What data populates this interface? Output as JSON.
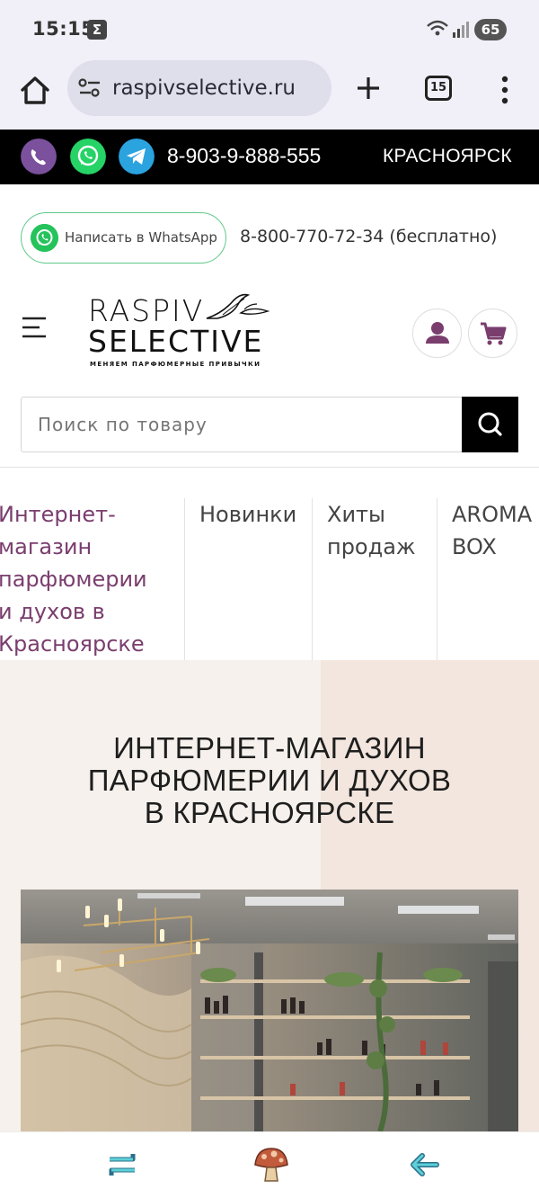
{
  "status_bar": {
    "time": "15:15",
    "notification_icon": "sigma-icon",
    "battery": "65"
  },
  "browser": {
    "url": "raspivselective.ru",
    "tab_count": "15"
  },
  "top_bar": {
    "phone": "8-903-9-888-555",
    "city": "КРАСНОЯРСК",
    "colors": {
      "viber": "#7b519d",
      "whatsapp": "#25d366",
      "telegram": "#2aa3df"
    }
  },
  "contact_row": {
    "whatsapp_label": "Написать в WhatsApp",
    "free_phone": "8-800-770-72-34 (бесплатно)"
  },
  "logo": {
    "line1": "RASPIV",
    "line2": "SELECTIVE",
    "tagline": "МЕНЯЕМ ПАРФЮМЕРНЫЕ ПРИВЫЧКИ"
  },
  "search": {
    "placeholder": "Поиск по товару"
  },
  "nav_menu": [
    {
      "lines": [
        "Интернет-",
        "магазин",
        "парфюмерии",
        "и духов в",
        "Красноярске"
      ]
    },
    {
      "lines": [
        "Новинки"
      ]
    },
    {
      "lines": [
        "Хиты",
        "продаж"
      ]
    },
    {
      "lines": [
        "AROMA",
        "BOX"
      ]
    }
  ],
  "hero": {
    "title_lines": [
      "ИНТЕРНЕТ-МАГАЗИН",
      "ПАРФЮМЕРИИ И ДУХОВ",
      "В КРАСНОЯРСКЕ"
    ]
  },
  "accent_color": "#7a3e6e"
}
